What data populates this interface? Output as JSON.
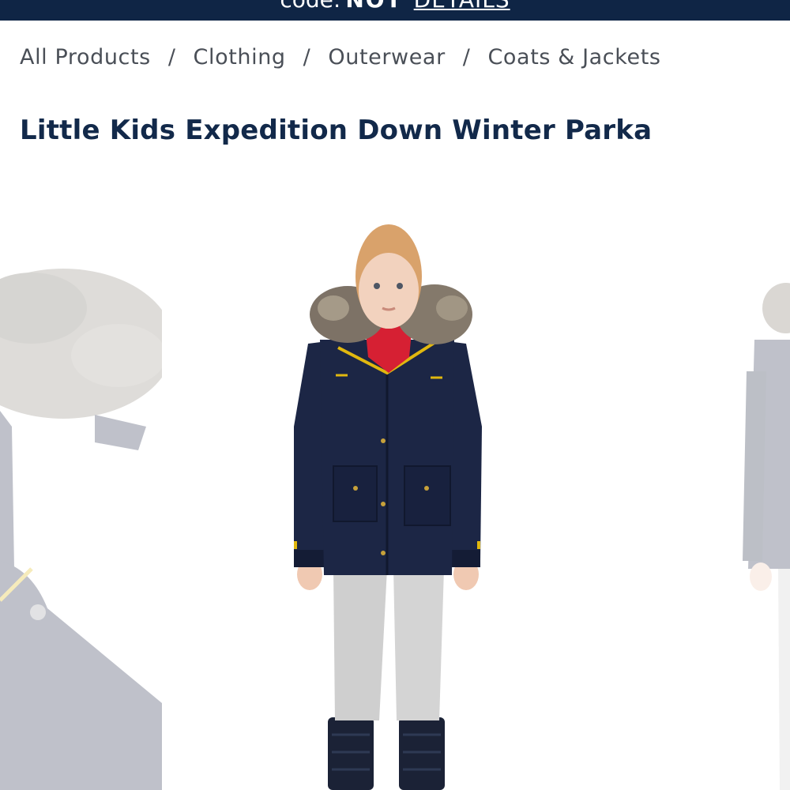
{
  "promo": {
    "text": "code:",
    "code": "NOT",
    "link_label": "DETAILS"
  },
  "breadcrumb": {
    "items": [
      "All Products",
      "Clothing",
      "Outerwear",
      "Coats & Jackets"
    ],
    "separator": "/"
  },
  "product": {
    "title": "Little Kids Expedition Down Winter Parka"
  },
  "colors": {
    "banner": "#0f2545",
    "title": "#12294a",
    "breadcrumb": "#4a4f57",
    "parka": "#1c2645",
    "trim": "#e1b80f"
  },
  "images": {
    "current_index": 2,
    "main": "parka-model-front-icon",
    "previous": "parka-hood-closeup-icon",
    "next": "parka-model-side-icon"
  }
}
